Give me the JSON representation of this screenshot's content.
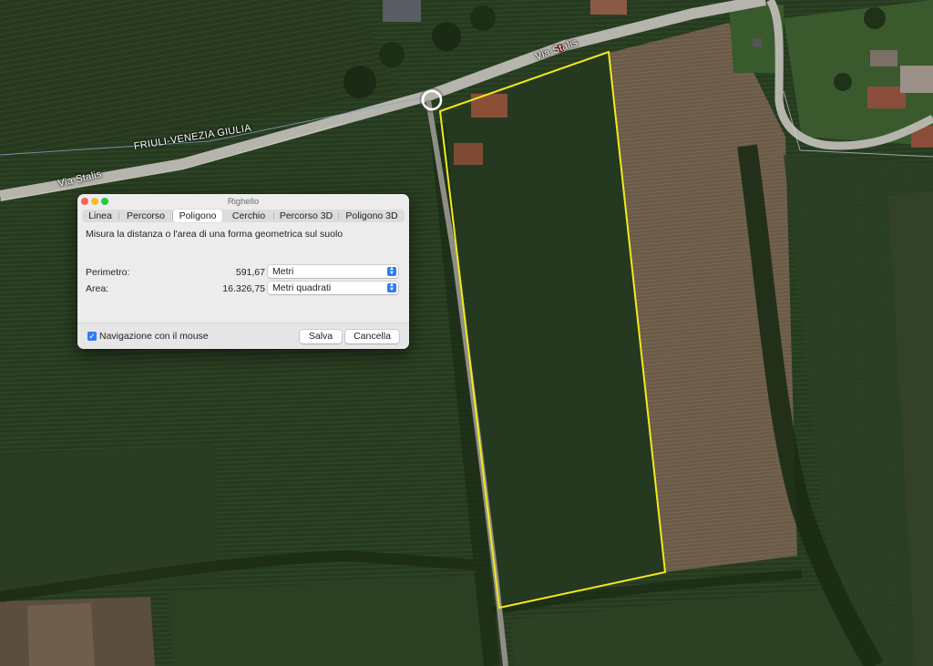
{
  "map": {
    "region_label": "FRIULI-VENEZIA GIULIA",
    "road_label_1": "Via Stalis",
    "road_label_2": "Via Stalis"
  },
  "dialog": {
    "title": "Righello",
    "tabs": [
      {
        "label": "Linea",
        "selected": false
      },
      {
        "label": "Percorso",
        "selected": false
      },
      {
        "label": "Poligono",
        "selected": true
      },
      {
        "label": "Cerchio",
        "selected": false
      },
      {
        "label": "Percorso 3D",
        "selected": false
      },
      {
        "label": "Poligono 3D",
        "selected": false
      }
    ],
    "description": "Misura la distanza o l'area di una forma geometrica sul suolo",
    "perimeter": {
      "label": "Perimetro:",
      "value": "591,67",
      "unit": "Metri"
    },
    "area": {
      "label": "Area:",
      "value": "16.326,75",
      "unit": "Metri quadrati"
    },
    "mouse_nav": {
      "label": "Navigazione con il mouse",
      "checked": true
    },
    "save_label": "Salva",
    "cancel_label": "Cancella"
  },
  "colors": {
    "accent": "#2f7cf6",
    "polygon": "#f2ea1e",
    "close": "#fe5f57",
    "minimize": "#febc2e",
    "zoom": "#28c840"
  }
}
